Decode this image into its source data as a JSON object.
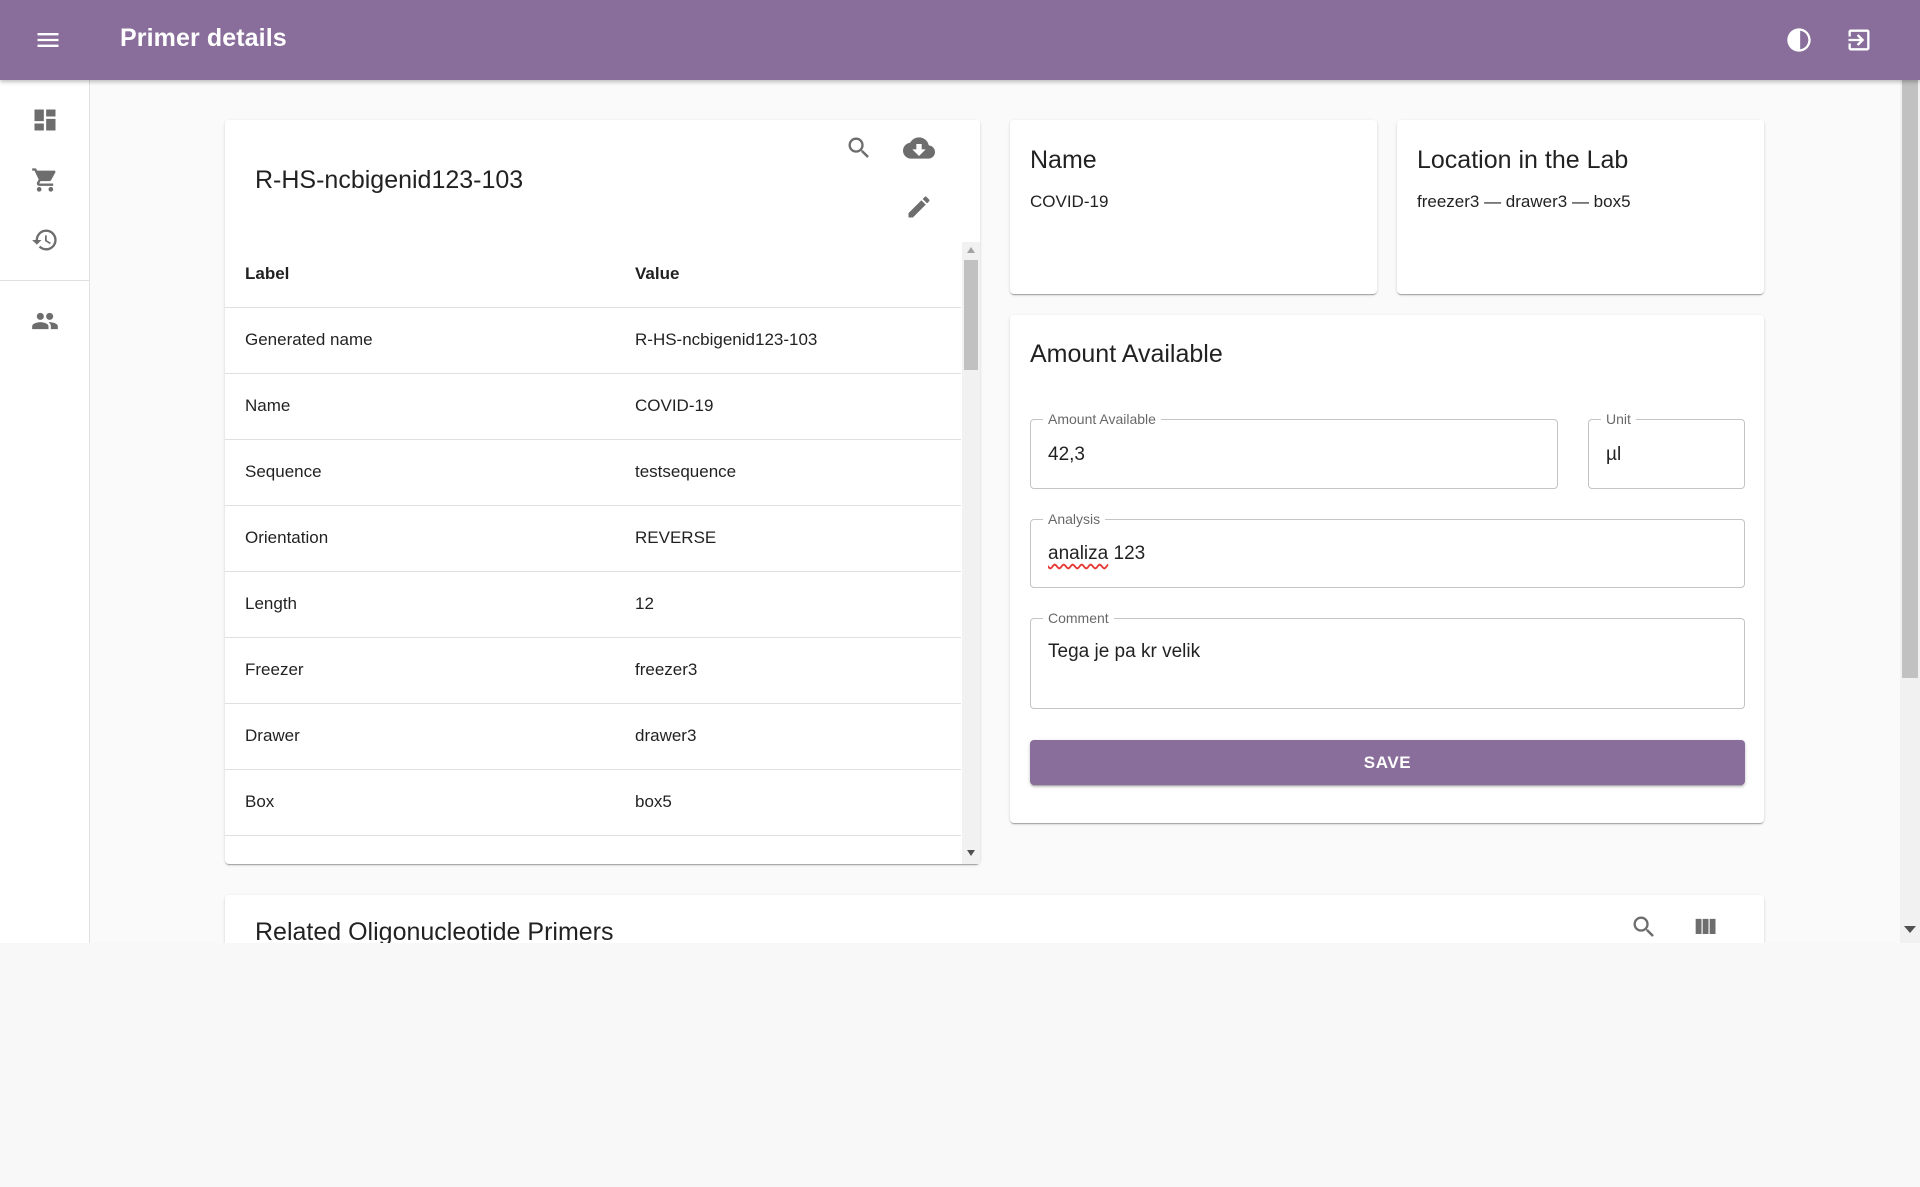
{
  "app": {
    "title": "Primer details",
    "colors": {
      "primary": "#896d9a",
      "background": "#fafafa"
    }
  },
  "header_icons": [
    "menu-icon",
    "theme-toggle-icon",
    "logout-icon"
  ],
  "sidebar": {
    "items": [
      {
        "name": "dashboard",
        "icon": "dashboard-icon"
      },
      {
        "name": "orders",
        "icon": "cart-icon"
      },
      {
        "name": "history",
        "icon": "history-icon"
      },
      {
        "name": "users",
        "icon": "people-icon"
      }
    ]
  },
  "details_card": {
    "title": "R-HS-ncbigenid123-103",
    "toolbar_icons": [
      "search-icon",
      "cloud-download-icon",
      "edit-icon"
    ],
    "columns": {
      "label": "Label",
      "value": "Value"
    },
    "rows": [
      {
        "label": "Generated name",
        "value": "R-HS-ncbigenid123-103"
      },
      {
        "label": "Name",
        "value": "COVID-19"
      },
      {
        "label": "Sequence",
        "value": "testsequence"
      },
      {
        "label": "Orientation",
        "value": "REVERSE"
      },
      {
        "label": "Length",
        "value": "12"
      },
      {
        "label": "Freezer",
        "value": "freezer3"
      },
      {
        "label": "Drawer",
        "value": "drawer3"
      },
      {
        "label": "Box",
        "value": "box5"
      }
    ]
  },
  "name_card": {
    "title": "Name",
    "value": "COVID-19"
  },
  "location_card": {
    "title": "Location in the Lab",
    "value": "freezer3 — drawer3 — box5"
  },
  "amount_card": {
    "title": "Amount Available",
    "amount": {
      "label": "Amount Available",
      "value": "42,3"
    },
    "unit": {
      "label": "Unit",
      "value": "µl"
    },
    "analysis": {
      "label": "Analysis",
      "value_misspelled": "analiza",
      "value_rest": " 123"
    },
    "comment": {
      "label": "Comment",
      "value": "Tega je pa kr velik"
    },
    "save_label": "SAVE"
  },
  "related_card": {
    "title": "Related Oligonucleotide Primers",
    "toolbar_icons": [
      "search-icon",
      "columns-icon"
    ]
  }
}
